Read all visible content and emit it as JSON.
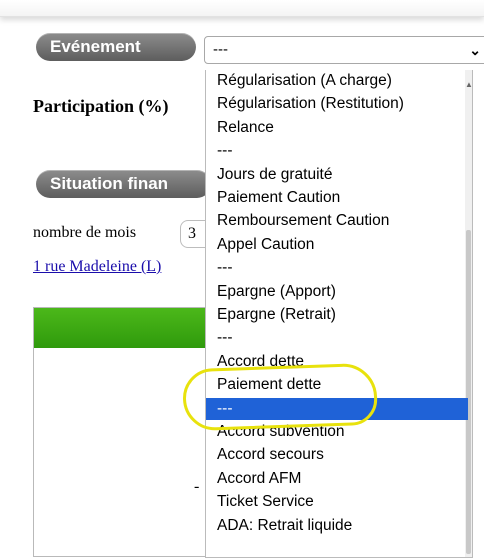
{
  "header_bar": {},
  "evenement": {
    "label": "Evénement",
    "selected_value": "---",
    "options": [
      "Régularisation (A charge)",
      "Régularisation (Restitution)",
      "Relance",
      "---",
      "Jours de gratuité",
      "Paiement Caution",
      "Remboursement Caution",
      "Appel Caution",
      "---",
      "Epargne (Apport)",
      "Epargne (Retrait)",
      "---",
      "Accord dette",
      "Paiement dette",
      "---",
      "Accord subvention",
      "Accord secours",
      "Accord AFM",
      "Ticket Service",
      "ADA: Retrait liquide"
    ],
    "highlighted_index": 14
  },
  "participation": {
    "label": "Participation (%)"
  },
  "situation": {
    "label": "Situation finan",
    "mois_label": "nombre de mois",
    "mois_value": "3",
    "address_link": "1 rue Madeleine (L)",
    "panel_dash": "-"
  },
  "colors": {
    "panel_header": "#3aa712",
    "selection": "#1f62d7",
    "annotation": "#e8e20d",
    "link": "#1a0dab"
  }
}
